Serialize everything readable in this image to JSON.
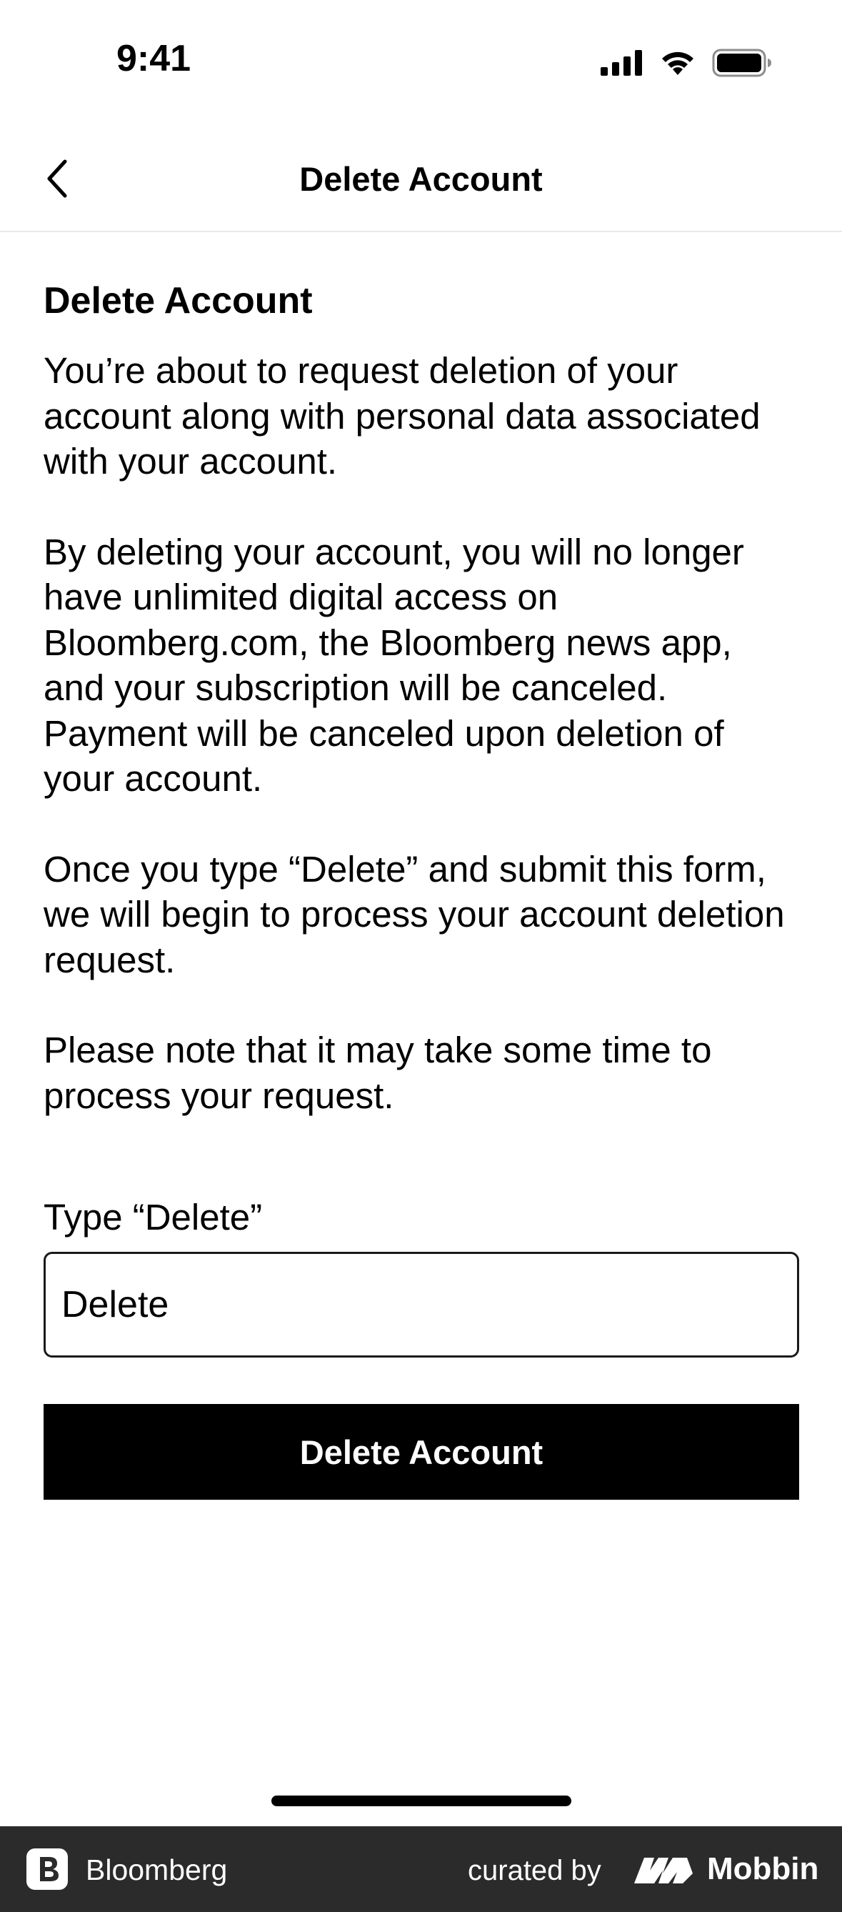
{
  "status_bar": {
    "time": "9:41"
  },
  "nav": {
    "title": "Delete Account"
  },
  "content": {
    "heading": "Delete Account",
    "paragraphs": [
      "You’re about to request deletion of your account along with personal data associated with your account.",
      "By deleting your account, you will no longer have unlimited digital access on Bloomberg.com, the Bloomberg news app, and your subscription will be canceled. Payment will be canceled upon deletion of your account.",
      "Once you type “Delete” and submit this form, we will begin to process your account deletion request.",
      "Please note that it may take some time to process your request."
    ]
  },
  "form": {
    "label": "Type “Delete”",
    "input_value": "Delete",
    "submit_label": "Delete Account"
  },
  "footer": {
    "brand": "Bloomberg",
    "curated_by": "curated by",
    "mobbin": "Mobbin"
  }
}
